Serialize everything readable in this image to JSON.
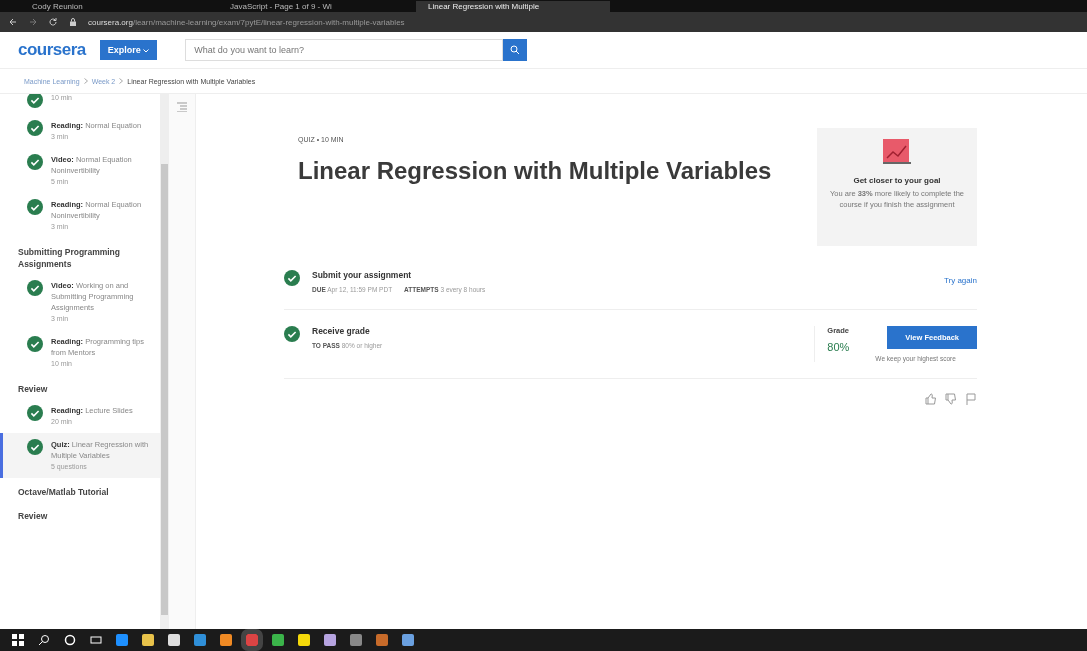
{
  "browser": {
    "tabs": [
      {
        "title": "Cody Reunion",
        "selected": false
      },
      {
        "title": "JavaScript - Page 1 of 9 - Wi",
        "selected": false
      },
      {
        "title": "Linear Regression with Multiple",
        "selected": true
      }
    ],
    "url_host": "coursera.org",
    "url_path": "/learn/machine-learning/exam/7pytE/linear-regression-with-multiple-variables"
  },
  "header": {
    "logo": "coursera",
    "explore": "Explore",
    "search_placeholder": "What do you want to learn?"
  },
  "breadcrumb": [
    "Machine Learning",
    "Week 2",
    "Linear Regression with Multiple Variables"
  ],
  "sidebar": {
    "items": [
      {
        "kind": "item",
        "meta": "10 min",
        "completed": true,
        "selected": false
      },
      {
        "kind": "item",
        "type": "Reading:",
        "title": "Normal Equation",
        "meta": "3 min",
        "completed": true,
        "selected": false
      },
      {
        "kind": "item",
        "type": "Video:",
        "title": "Normal Equation Noninvertibility",
        "meta": "5 min",
        "completed": true,
        "selected": false
      },
      {
        "kind": "item",
        "type": "Reading:",
        "title": "Normal Equation Noninvertibility",
        "meta": "3 min",
        "completed": true,
        "selected": false
      },
      {
        "kind": "section",
        "title": "Submitting Programming Assignments"
      },
      {
        "kind": "item",
        "type": "Video:",
        "title": "Working on and Submitting Programming Assignments",
        "meta": "3 min",
        "completed": true,
        "selected": false
      },
      {
        "kind": "item",
        "type": "Reading:",
        "title": "Programming tips from Mentors",
        "meta": "10 min",
        "completed": true,
        "selected": false
      },
      {
        "kind": "section",
        "title": "Review"
      },
      {
        "kind": "item",
        "type": "Reading:",
        "title": "Lecture Slides",
        "meta": "20 min",
        "completed": true,
        "selected": false
      },
      {
        "kind": "item",
        "type": "Quiz:",
        "title": "Linear Regression with Multiple Variables",
        "meta": "5 questions",
        "completed": true,
        "selected": true
      },
      {
        "kind": "section",
        "title": "Octave/Matlab Tutorial"
      },
      {
        "kind": "section",
        "title": "Review"
      }
    ]
  },
  "main": {
    "eyebrow": "QUIZ • 10 MIN",
    "title": "Linear Regression with Multiple Variables",
    "goal_card": {
      "title": "Get closer to your goal",
      "text": "You are **33%** more likely to complete the course if you finish the assignment"
    },
    "steps": [
      {
        "kind": "submit",
        "completed": true,
        "title": "Submit your assignment",
        "details": [
          {
            "label": "DUE",
            "value": "Apr 12, 11:59 PM PDT"
          },
          {
            "label": "ATTEMPTS",
            "value": "3 every 8 hours"
          }
        ],
        "action": "Try again"
      },
      {
        "kind": "grade",
        "completed": true,
        "title": "Receive grade",
        "details": [
          {
            "label": "TO PASS",
            "value": "80% or higher"
          }
        ],
        "grade_label": "Grade",
        "grade": "80%",
        "button": "View Feedback",
        "note": "We keep your highest score"
      }
    ]
  }
}
